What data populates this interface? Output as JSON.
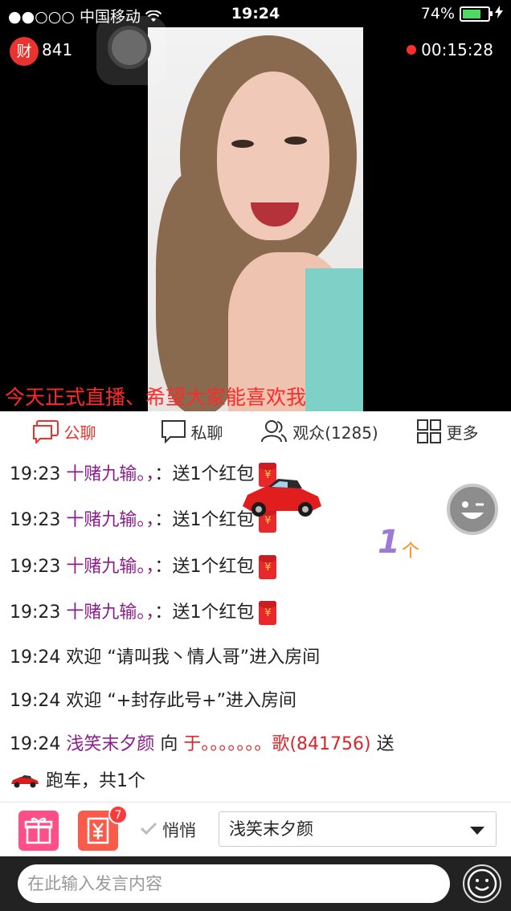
{
  "status_bar": {
    "signal": "●●○○○",
    "carrier": "中国移动",
    "time": "19:24",
    "battery_percent": "74%",
    "battery_level": 0.74
  },
  "room": {
    "coin_icon_text": "财",
    "coin_count": "841",
    "live_duration": "00:15:28",
    "banner_text": "今天正式直播、希望大家能喜欢我"
  },
  "tabs": [
    {
      "label": "公聊",
      "icon": "chat-bubble-icon",
      "active": true
    },
    {
      "label": "私聊",
      "icon": "private-chat-icon",
      "active": false
    },
    {
      "label": "观众(1285)",
      "icon": "audience-icon",
      "active": false
    },
    {
      "label": "更多",
      "icon": "grid-icon",
      "active": false
    }
  ],
  "chat": {
    "messages": [
      {
        "time": "19:23",
        "user": "十赌九输。，",
        "sep": "：",
        "text": "送1个红包",
        "icon": "red-envelope-icon"
      },
      {
        "time": "19:23",
        "user": "十赌九输。，",
        "sep": "：",
        "text": "送1个红包",
        "icon": "red-envelope-icon"
      },
      {
        "time": "19:23",
        "user": "十赌九输。，",
        "sep": "：",
        "text": "送1个红包",
        "icon": "red-envelope-icon"
      },
      {
        "time": "19:23",
        "user": "十赌九输。，",
        "sep": "：",
        "text": "送1个红包",
        "icon": "red-envelope-icon"
      },
      {
        "time": "19:24",
        "text": "欢迎 “请叫我丶情人哥”进入房间"
      },
      {
        "time": "19:24",
        "text": "欢迎 “+封存此号+”进入房间"
      },
      {
        "time": "19:24",
        "user": "浅笑末夕颜",
        "mid": " 向 ",
        "target": "于。。。。。。。歌",
        "target_id": "(841756)",
        "tail": " 送",
        "line2": " 跑车，共1个"
      }
    ],
    "gift_animation_count": "1",
    "gift_animation_unit": "个"
  },
  "bottom": {
    "gift_badge": "7",
    "quiet_label": "悄悄",
    "recipient": "浅笑末夕颜",
    "input_placeholder": "在此输入发言内容"
  },
  "colors": {
    "accent": "#e8332e",
    "username": "#8a1e8a",
    "gift_button": "#ff4f86",
    "money_button": "#fa5a4a"
  }
}
